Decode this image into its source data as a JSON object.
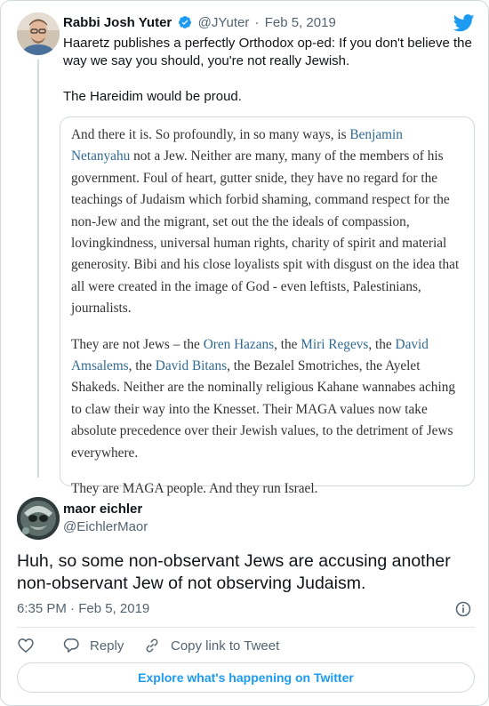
{
  "quoted_tweet": {
    "author_name": "Rabbi Josh Yuter",
    "handle": "@JYuter",
    "separator": "·",
    "date": "Feb 5, 2019",
    "text": "Haaretz publishes a perfectly Orthodox op-ed: If you don't believe the way we say you should, you're not really Jewish.\n\nThe Hareidim would be proud.",
    "verified": true
  },
  "excerpt": {
    "p1_a": "And there it is. So profoundly, in so many ways, is ",
    "p1_link": "Benjamin Netanyahu",
    "p1_b": " not a Jew. Neither are many, many of the members of his government. Foul of heart, gutter snide, they have no regard for the teachings of Judaism which forbid shaming, command respect for the non-Jew and the migrant, set out the the ideals of compassion, lovingkindness, universal human rights, charity of spirit and material generosity. Bibi and his close loyalists spit with disgust on the idea that all were created in the image of God - even leftists, Palestinians, journalists.",
    "p2_a": "They are not Jews – the ",
    "p2_link1": "Oren Hazans",
    "p2_b": ", the ",
    "p2_link2": "Miri Regevs",
    "p2_c": ", the ",
    "p2_link3": "David Amsalems",
    "p2_d": ", the ",
    "p2_link4": "David Bitans",
    "p2_e": ", the Bezalel Smotriches, the Ayelet Shakeds. Neither are the nominally religious Kahane wannabes aching to claw their way into the Knesset. Their MAGA values now take absolute precedence over their Jewish values, to the detriment of Jews everywhere.",
    "p3": "They are MAGA people. And they run Israel."
  },
  "main_tweet": {
    "author_name": "maor eichler",
    "handle": "@EichlerMaor",
    "text": "Huh, so some non-observant Jews are accusing another non-observant Jew of not observing Judaism.",
    "timestamp": "6:35 PM · Feb 5, 2019"
  },
  "actions": {
    "reply_label": "Reply",
    "copy_link_label": "Copy link to Tweet"
  },
  "explore_button": {
    "label": "Explore what's happening on Twitter"
  },
  "colors": {
    "accent": "#1d9bf0",
    "secondary_text": "#536471",
    "link_serif": "#316a91",
    "border": "#cfd9de"
  },
  "icons": [
    "twitter-bird-icon",
    "verified-badge-icon",
    "info-icon",
    "heart-icon",
    "reply-icon",
    "link-icon"
  ]
}
